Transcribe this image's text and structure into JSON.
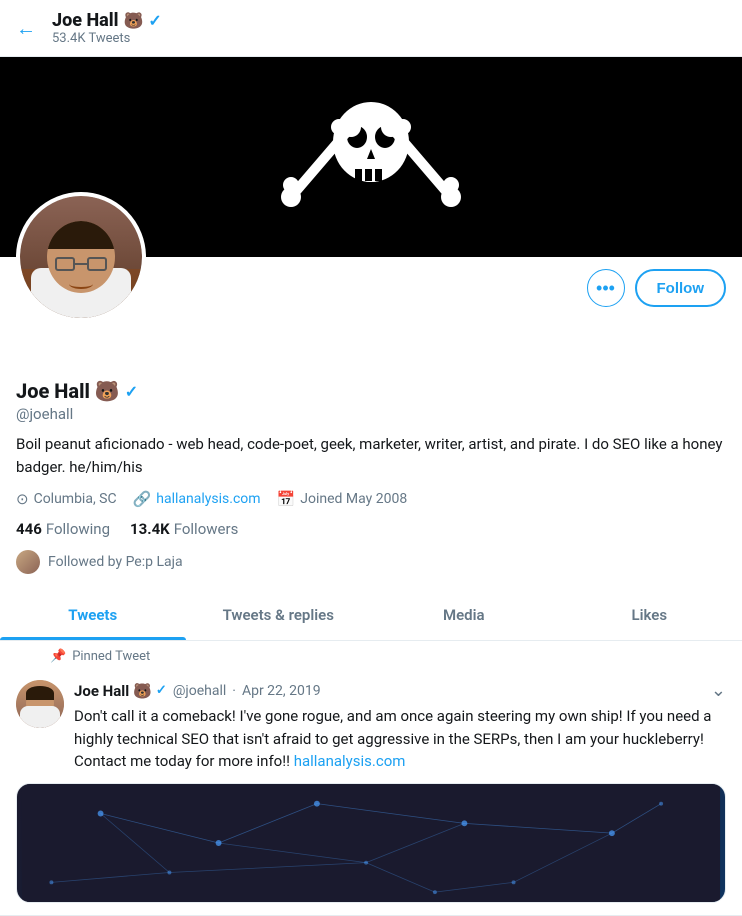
{
  "topBar": {
    "backLabel": "←",
    "userName": "Joe Hall",
    "userEmoji": "🐻",
    "verifiedLabel": "✓",
    "tweetsCount": "53.4K Tweets"
  },
  "profile": {
    "displayName": "Joe Hall",
    "emoji": "🐻",
    "username": "@joehall",
    "bio": "Boil peanut aficionado - web head, code-poet, geek, marketer, writer, artist, and pirate. I do SEO like a honey badger. he/him/his",
    "location": "Columbia, SC",
    "website": "hallanalysis.com",
    "websiteUrl": "hallanalysis.com",
    "joined": "Joined May 2008",
    "following": "446",
    "followingLabel": "Following",
    "followers": "13.4K",
    "followersLabel": "Followers",
    "followedBy": "Followed by Pe:p Laja"
  },
  "buttons": {
    "moreLabel": "•••",
    "followLabel": "Follow"
  },
  "tabs": [
    {
      "label": "Tweets",
      "active": true
    },
    {
      "label": "Tweets & replies",
      "active": false
    },
    {
      "label": "Media",
      "active": false
    },
    {
      "label": "Likes",
      "active": false
    }
  ],
  "pinnedTweet": {
    "pinnedLabel": "Pinned Tweet",
    "avatarAlt": "Joe Hall avatar",
    "name": "Joe Hall",
    "emoji": "🐻",
    "handle": "@joehall",
    "date": "Apr 22, 2019",
    "text": "Don't call it a comeback! I've gone rogue, and am once again steering my own ship! If you need a highly technical SEO that isn't afraid to get aggressive in the SERPs, then I am your huckleberry! Contact me today for more info!!",
    "link": "hallanalysis.com"
  },
  "icons": {
    "location": "⊙",
    "link": "🔗",
    "calendar": "📅",
    "pin": "📌"
  }
}
